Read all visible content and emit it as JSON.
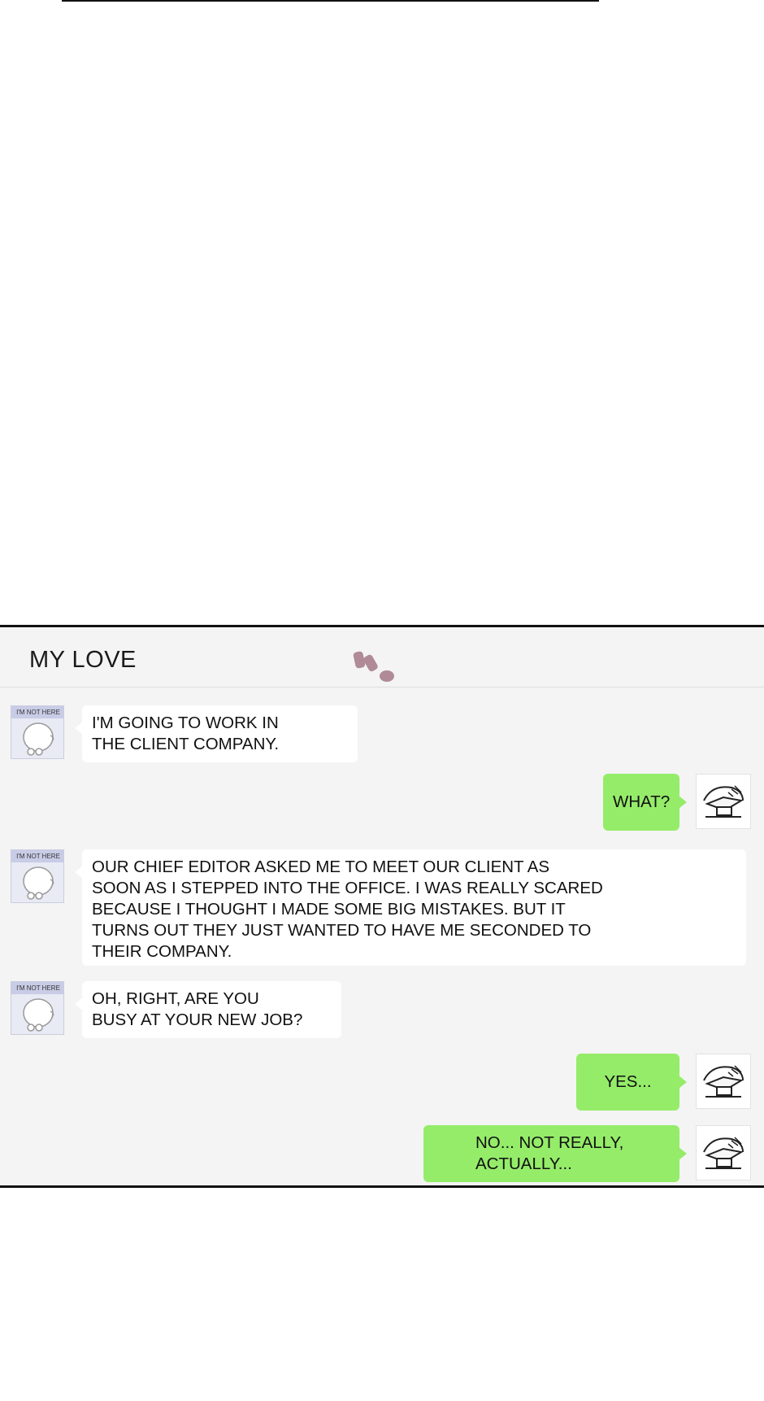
{
  "chat": {
    "title": "MY LOVE",
    "avatar_tag": "I'M NOT HERE",
    "messages": [
      {
        "from": "them",
        "text": "I'M GOING TO WORK IN\nTHE CLIENT COMPANY."
      },
      {
        "from": "me",
        "text": "WHAT?"
      },
      {
        "from": "them",
        "text": "OUR CHIEF EDITOR ASKED ME TO MEET OUR CLIENT AS\nSOON AS I STEPPED INTO THE OFFICE. I WAS REALLY SCARED\nBECAUSE I THOUGHT I MADE SOME BIG MISTAKES. BUT IT\nTURNS OUT THEY JUST WANTED TO HAVE ME SECONDED TO\nTHEIR COMPANY."
      },
      {
        "from": "them",
        "text": "OH, RIGHT, ARE YOU\nBUSY AT YOUR NEW JOB?"
      },
      {
        "from": "me",
        "text": "YES..."
      },
      {
        "from": "me",
        "text": "NO... NOT REALLY,\nACTUALLY..."
      }
    ]
  },
  "colors": {
    "my_bubble": "#95ec69",
    "their_bubble": "#ffffff",
    "chat_background": "#f4f4f4"
  }
}
